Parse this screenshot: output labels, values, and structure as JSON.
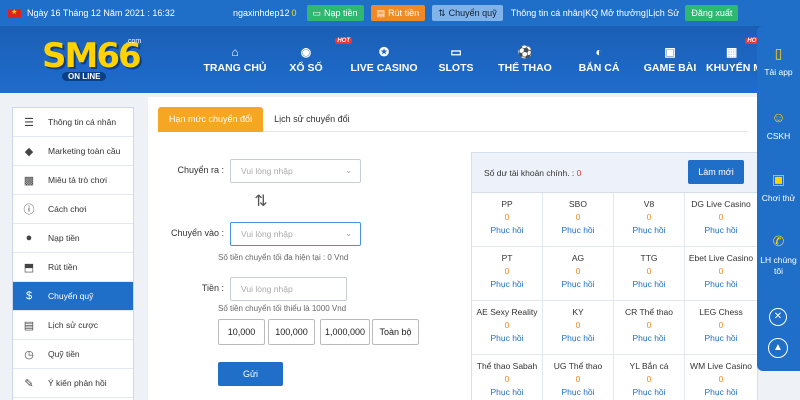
{
  "topbar": {
    "date": "Ngày 16 Tháng 12 Năm 2021 : 16:32",
    "username": "ngaxinhdep12",
    "balance": "0",
    "deposit": "Nạp tiền",
    "withdraw": "Rút tiền",
    "transfer": "Chuyển quỹ",
    "links": "Thông tin cá nhân|KQ Mở thưởng|Lịch Sử",
    "logout": "Đăng xuất"
  },
  "logo": {
    "main": "SM66",
    "sub": "ON LINE",
    "com": ".com"
  },
  "nav": [
    {
      "label": "TRANG CHỦ",
      "icon": "home-icon"
    },
    {
      "label": "XỔ SỐ",
      "icon": "lottery-icon",
      "badge": "HOT"
    },
    {
      "label": "LIVE CASINO",
      "icon": "casino-chip-icon"
    },
    {
      "label": "SLOTS",
      "icon": "slot-icon"
    },
    {
      "label": "THỂ THAO",
      "icon": "soccer-ball-icon"
    },
    {
      "label": "BẮN CÁ",
      "icon": "fish-icon"
    },
    {
      "label": "GAME BÀI",
      "icon": "cards-icon"
    },
    {
      "label": "KHUYẾN M",
      "icon": "gift-icon",
      "badge": "HOT"
    }
  ],
  "sidebar": [
    {
      "label": "Thông tin cá nhân",
      "icon": "user-card-icon"
    },
    {
      "label": "Marketing toàn cầu",
      "icon": "diamond-icon"
    },
    {
      "label": "Miêu tả trò chơi",
      "icon": "gamepad-icon"
    },
    {
      "label": "Cách chơi",
      "icon": "info-icon"
    },
    {
      "label": "Nạp tiền",
      "icon": "piggy-bank-icon"
    },
    {
      "label": "Rút tiền",
      "icon": "withdraw-icon"
    },
    {
      "label": "Chuyển quỹ",
      "icon": "transfer-dollar-icon",
      "active": true
    },
    {
      "label": "Lịch sử cược",
      "icon": "history-icon"
    },
    {
      "label": "Quỹ tiền",
      "icon": "fund-icon"
    },
    {
      "label": "Ý kiến phản hồi",
      "icon": "feedback-icon"
    }
  ],
  "tabs": [
    "Hạn mức chuyển đổi",
    "Lịch sử chuyển đổi"
  ],
  "form": {
    "from_label": "Chuyển ra :",
    "from_placeholder": "Vui lòng nhập",
    "to_label": "Chuyển vào :",
    "to_placeholder": "Vui lòng nhập",
    "max_note": "Số tiền chuyển tối đa hiện tại : 0 Vnd",
    "amount_label": "Tiền :",
    "amount_placeholder": "Vui lòng nhập",
    "min_note": "Số tiền chuyển tối thiểu là 1000 Vnd",
    "quick_amounts": [
      "10,000",
      "100,000",
      "1,000,000",
      "Toàn bộ"
    ],
    "submit": "Gửi"
  },
  "balance": {
    "title": "Số dư tài khoản chính. : ",
    "value": "0",
    "refresh": "Làm mới",
    "action_label": "Phục hồi",
    "providers": [
      {
        "name": "PP",
        "value": "0"
      },
      {
        "name": "SBO",
        "value": "0"
      },
      {
        "name": "V8",
        "value": "0"
      },
      {
        "name": "DG Live Casino",
        "value": "0"
      },
      {
        "name": "PT",
        "value": "0"
      },
      {
        "name": "AG",
        "value": "0"
      },
      {
        "name": "TTG",
        "value": "0"
      },
      {
        "name": "Ebet Live Casino",
        "value": "0"
      },
      {
        "name": "AE Sexy Reality",
        "value": "0"
      },
      {
        "name": "KY",
        "value": "0"
      },
      {
        "name": "CR Thể thao",
        "value": "0"
      },
      {
        "name": "LEG Chess",
        "value": "0"
      },
      {
        "name": "Thể thao Sabah",
        "value": "0"
      },
      {
        "name": "UG Thể thao",
        "value": "0"
      },
      {
        "name": "YL Bắn cá",
        "value": "0"
      },
      {
        "name": "WM Live Casino",
        "value": "0"
      }
    ]
  },
  "float": [
    {
      "label": "Tải app",
      "icon": "mobile-icon"
    },
    {
      "label": "CSKH",
      "icon": "support-agent-icon"
    },
    {
      "label": "Chơi thử",
      "icon": "gamepad-icon"
    },
    {
      "label": "LH chúng tôi",
      "icon": "phone-icon"
    }
  ],
  "colors": {
    "primary": "#1f6fc9",
    "accent": "#f5a623",
    "success": "#2eb872",
    "value": "#f08a24"
  }
}
